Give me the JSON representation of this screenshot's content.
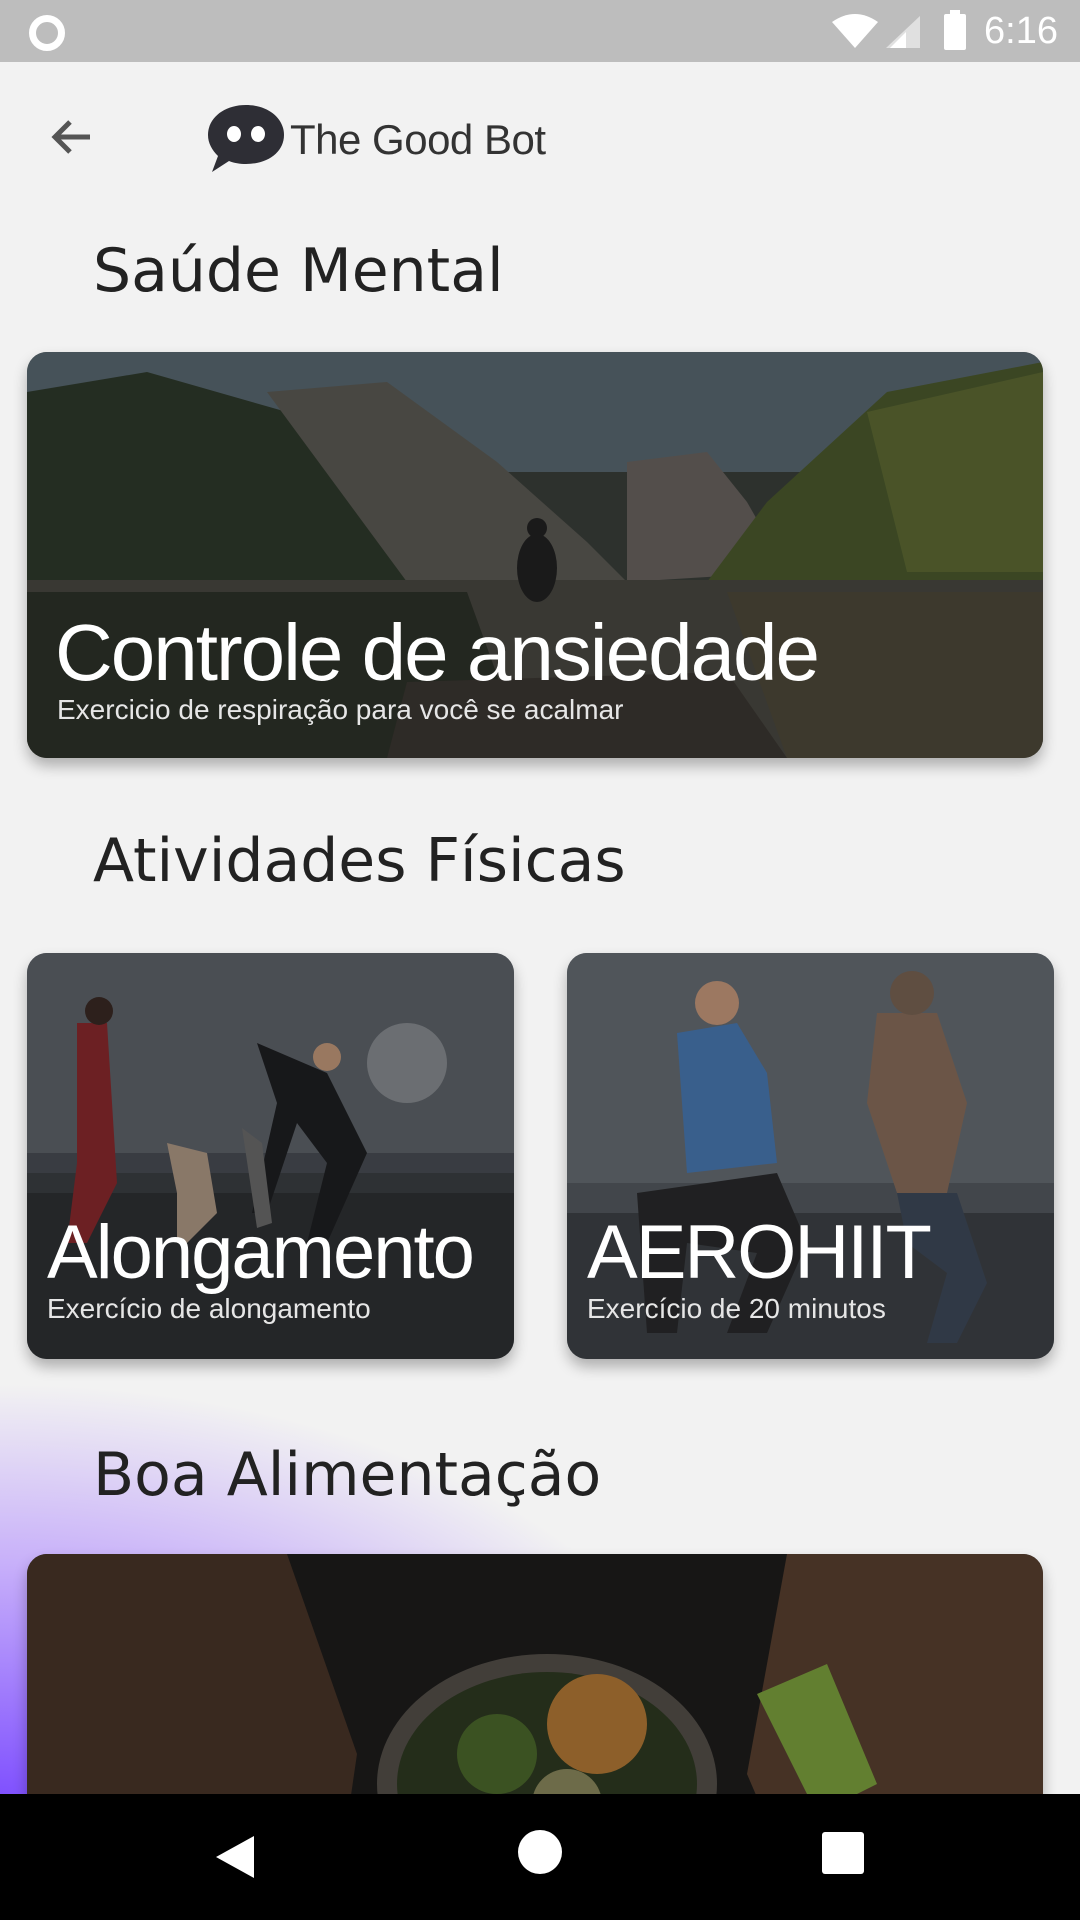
{
  "status_bar": {
    "time": "6:16",
    "icons": [
      "notification-ring-icon",
      "wifi-icon",
      "signal-icon",
      "battery-icon"
    ]
  },
  "header": {
    "app_name": "The Good Bot",
    "back_icon": "arrow-back-icon",
    "logo_icon": "chat-bot-logo-icon"
  },
  "sections": [
    {
      "title": "Saúde Mental",
      "cards": [
        {
          "title": "Controle de ansiedade",
          "subtitle": "Exercicio de respiração para você se acalmar"
        }
      ]
    },
    {
      "title": "Atividades Físicas",
      "cards": [
        {
          "title": "Alongamento",
          "subtitle": "Exercício de alongamento"
        },
        {
          "title": "AEROHIIT",
          "subtitle": "Exercício de 20 minutos"
        }
      ]
    },
    {
      "title": "Boa Alimentação",
      "cards": [
        {
          "title": "",
          "subtitle": ""
        }
      ]
    }
  ],
  "nav_bar": {
    "icons": [
      "nav-back-icon",
      "nav-home-icon",
      "nav-recents-icon"
    ]
  },
  "colors": {
    "accent_purple": "#7a4cff",
    "status_bar": "#bdbdbd",
    "background": "#f2f2f2"
  }
}
